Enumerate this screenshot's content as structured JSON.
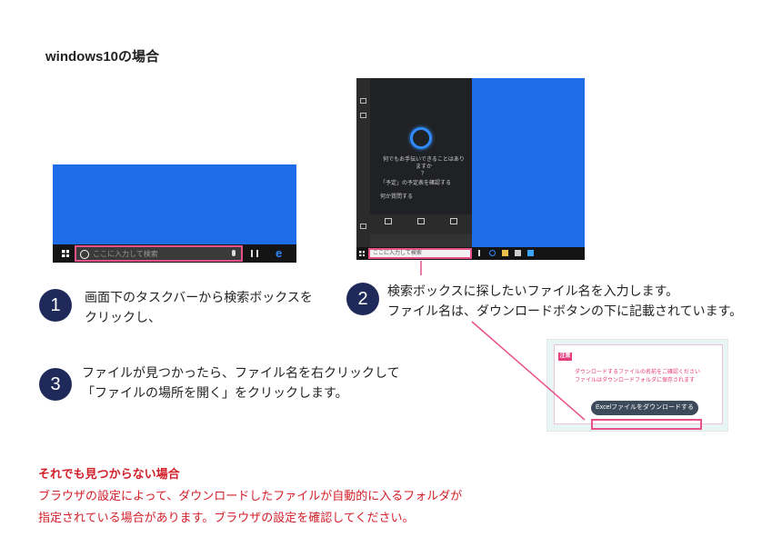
{
  "heading": "windows10の場合",
  "shot1": {
    "search_placeholder": "ここに入力して検索"
  },
  "shot2": {
    "cortana_prompt_l1": "何でもお手伝いできることはありますか",
    "cortana_prompt_l2": "？",
    "menu_item_1": "「予定」の予定表を確認する",
    "menu_item_2": "何か質問する",
    "search_placeholder": "ここに入力して検索"
  },
  "shot3": {
    "badge": "注意",
    "note_l1": "ダウンロードするファイルの名前をご確認ください",
    "note_l2": "ファイルはダウンロードフォルダに保存されます",
    "button": "Excelファイルをダウンロードする"
  },
  "steps": [
    {
      "number": "1",
      "lines": [
        "画面下のタスクバーから検索ボックスを",
        "クリックし、"
      ]
    },
    {
      "number": "2",
      "lines": [
        "検索ボックスに探したいファイル名を入力します。",
        "ファイル名は、ダウンロードボタンの下に記載されています。"
      ]
    },
    {
      "number": "3",
      "lines": [
        "ファイルが見つかったら、ファイル名を右クリックして",
        "「ファイルの場所を開く」をクリックします。"
      ]
    }
  ],
  "warning": {
    "title": "それでも見つからない場合",
    "lines": [
      "ブラウザの設定によって、ダウンロードしたファイルが自動的に入るフォルダが",
      "指定されている場合があります。ブラウザの設定を確認してください。"
    ]
  },
  "colors": {
    "accent_pink": "#e8508a",
    "badge_navy": "#1f2a5a",
    "desktop_blue": "#1e6ce8",
    "warning_red": "#d2202a"
  }
}
